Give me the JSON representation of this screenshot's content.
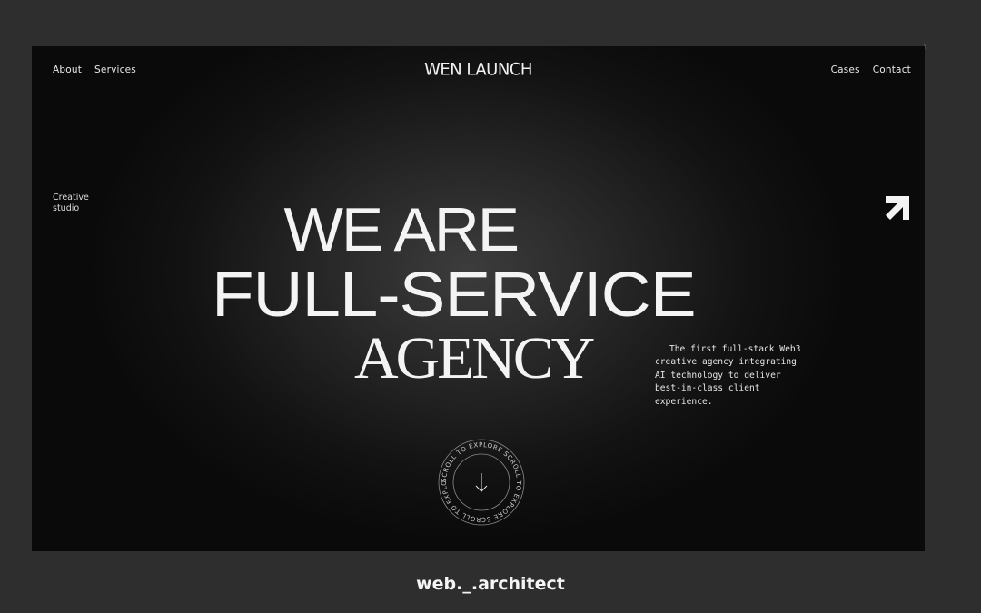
{
  "nav": {
    "left": [
      {
        "label": "About"
      },
      {
        "label": "Services"
      }
    ],
    "right": [
      {
        "label": "Cases"
      },
      {
        "label": "Contact"
      }
    ],
    "logo": "WEN LAUNCH"
  },
  "tagline": "Creative studio",
  "hero": {
    "line1": "WE ARE",
    "line2": "FULL-SERVICE",
    "line3": "AGENCY"
  },
  "description": "The first full-stack Web3 creative agency integrating AI technology to deliver best-in-class client experience.",
  "scroll_badge": {
    "ring_text": "SCROLL TO EXPLORE SCROLL TO EXPLORE SCROLL TO EXPLORE",
    "icon": "arrow-down-icon"
  },
  "arrow_link_icon": "arrow-up-right-icon",
  "credit": "web._.architect",
  "colors": {
    "page_background": "#2e2e2e",
    "frame_background": "#121212",
    "text": "#f4f4f4"
  }
}
